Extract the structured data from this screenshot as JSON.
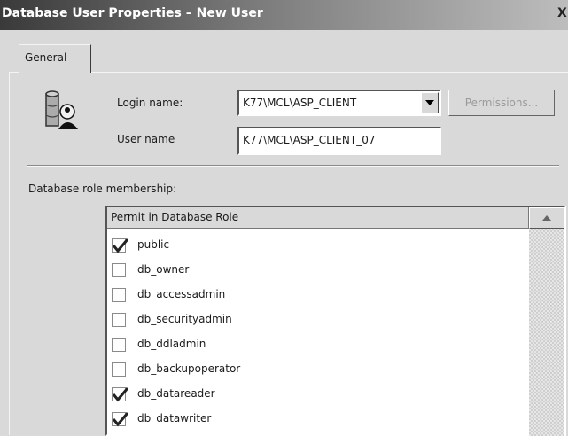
{
  "window": {
    "title": "Database User Properties – New User",
    "close_glyph": "X"
  },
  "tabs": [
    {
      "label": "General",
      "selected": true
    }
  ],
  "form": {
    "login_label": "Login name:",
    "login_value": "K77\\MCL\\ASP_CLIENT",
    "permissions_label": "Permissions...",
    "user_label": "User name",
    "user_value": "K77\\MCL\\ASP_CLIENT_07"
  },
  "roles_section": {
    "label": "Database role membership:",
    "header": "Permit in Database Role",
    "roles": [
      {
        "name": "public",
        "checked": true
      },
      {
        "name": "db_owner",
        "checked": false
      },
      {
        "name": "db_accessadmin",
        "checked": false
      },
      {
        "name": "db_securityadmin",
        "checked": false
      },
      {
        "name": "db_ddladmin",
        "checked": false
      },
      {
        "name": "db_backupoperator",
        "checked": false
      },
      {
        "name": "db_datareader",
        "checked": true
      },
      {
        "name": "db_datawriter",
        "checked": true
      }
    ]
  },
  "icons": {
    "user": "database-user-icon",
    "combo_arrow": "chevron-down-icon",
    "scroll_up": "scroll-up-arrow-icon",
    "check": "check-icon"
  },
  "colors": {
    "title_bar_start": "#3a3a3a",
    "title_bar_end": "#bdbdbd",
    "dialog_bg": "#d9d9d9"
  }
}
